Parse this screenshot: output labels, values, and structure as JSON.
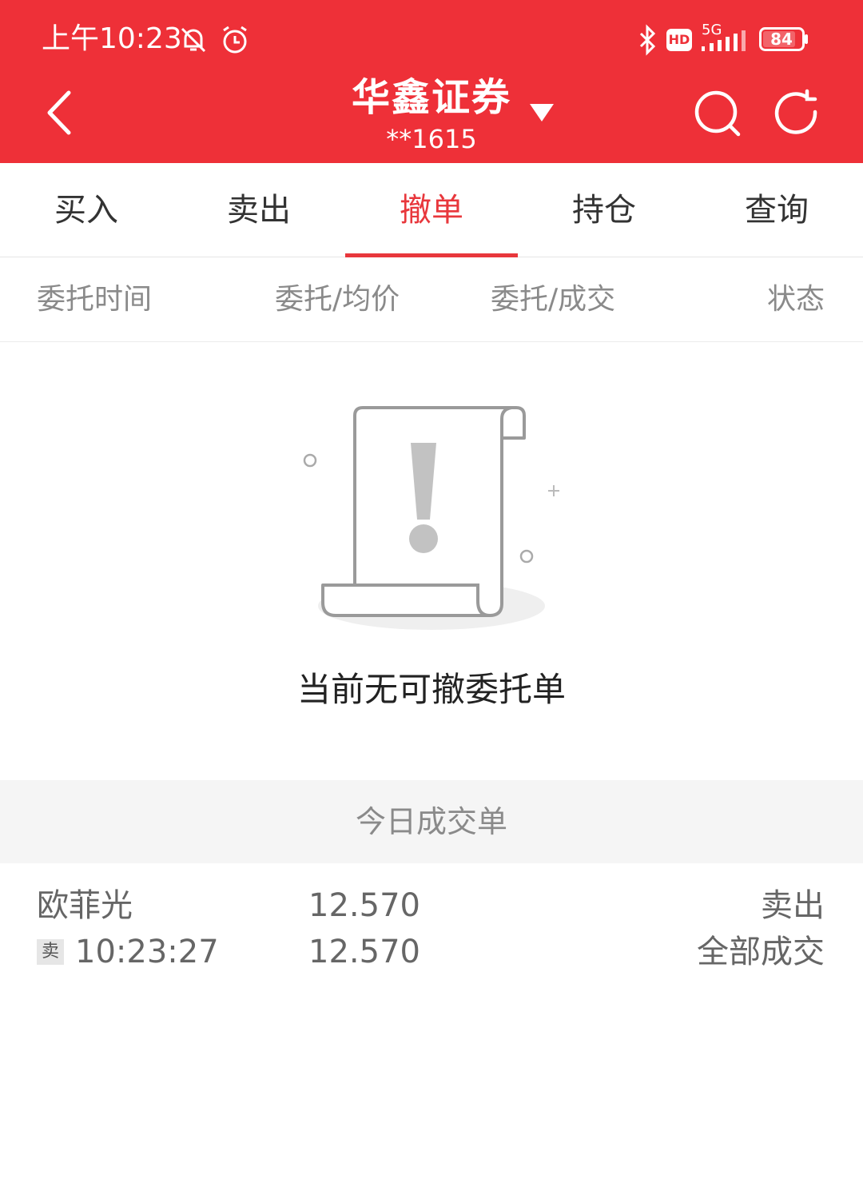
{
  "status_bar": {
    "time": "上午10:23",
    "network": "5G",
    "hd": "HD",
    "battery": "84"
  },
  "header": {
    "title": "华鑫证券",
    "account": "**1615",
    "icons": [
      "back-arrow-icon",
      "dropdown-triangle-icon",
      "search-icon",
      "refresh-icon"
    ]
  },
  "tabs": [
    {
      "label": "买入",
      "active": false
    },
    {
      "label": "卖出",
      "active": false
    },
    {
      "label": "撤单",
      "active": true
    },
    {
      "label": "持仓",
      "active": false
    },
    {
      "label": "查询",
      "active": false
    }
  ],
  "columns": [
    "委托时间",
    "委托/均价",
    "委托/成交",
    "状态"
  ],
  "empty_state": {
    "message": "当前无可撤委托单",
    "icon": "empty-document-icon"
  },
  "today_trades": {
    "title": "今日成交单",
    "rows": [
      {
        "name": "欧菲光",
        "badge": "卖",
        "time": "10:23:27",
        "order_price": "12.570",
        "avg_price": "12.570",
        "direction": "卖出",
        "status": "全部成交"
      }
    ]
  },
  "colors": {
    "header_bg": "#ee3038",
    "accent": "#e8373c",
    "band_bg": "#f5f5f5"
  }
}
